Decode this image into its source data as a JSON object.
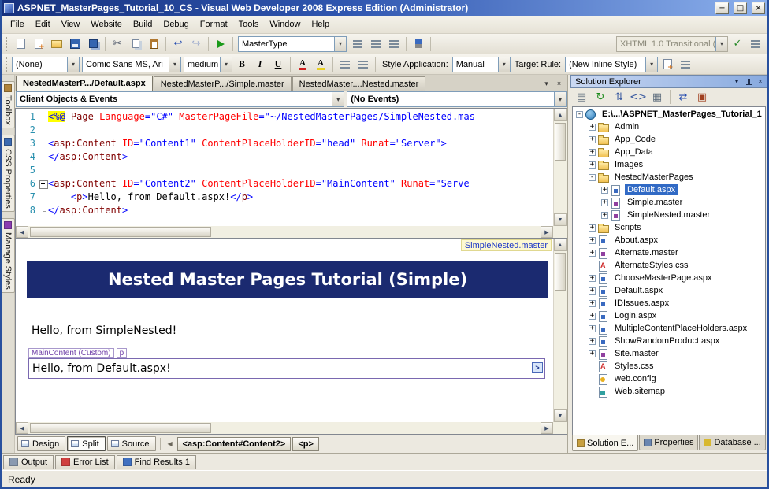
{
  "window": {
    "title": "ASPNET_MasterPages_Tutorial_10_CS - Visual Web Developer 2008 Express Edition (Administrator)"
  },
  "glyphs": {
    "up": "▲",
    "down": "▼",
    "left": "◀",
    "right": "▶",
    "dropdown": "▾",
    "close": "×",
    "minimize": "−",
    "maximize": "□"
  },
  "menu": {
    "items": [
      "File",
      "Edit",
      "View",
      "Website",
      "Build",
      "Debug",
      "Format",
      "Tools",
      "Window",
      "Help"
    ]
  },
  "toolbar_main": {
    "find_value": "MasterType",
    "doctype_value": "XHTML 1.0 Transitional (",
    "left_icons": [
      {
        "name": "new-web-site-icon",
        "type": "page"
      },
      {
        "name": "add-new-item-icon",
        "type": "page-plus"
      },
      {
        "name": "open-file-icon",
        "type": "folder"
      },
      {
        "name": "save-icon",
        "type": "floppy"
      },
      {
        "name": "save-all-icon",
        "type": "floppy-all"
      },
      {
        "type": "sep"
      },
      {
        "name": "cut-icon",
        "glyph": "✂",
        "color": "#555e6e"
      },
      {
        "name": "copy-icon",
        "type": "copy"
      },
      {
        "name": "paste-icon",
        "type": "paste"
      },
      {
        "type": "sep"
      },
      {
        "name": "undo-icon",
        "glyph": "↩",
        "color": "#2a50b0"
      },
      {
        "name": "redo-icon",
        "glyph": "↪",
        "color": "#2a50b0",
        "disabled": true
      },
      {
        "type": "sep"
      },
      {
        "name": "start-debugging-icon",
        "type": "play"
      },
      {
        "type": "sep"
      }
    ],
    "mid_icons": [
      {
        "name": "find-in-files-icon",
        "type": "lines"
      },
      {
        "name": "comment-selection-icon",
        "type": "lines"
      },
      {
        "name": "uncomment-selection-icon",
        "type": "lines"
      },
      {
        "type": "sep"
      },
      {
        "name": "bookmark-icon",
        "type": "flag"
      },
      {
        "type": "sep"
      }
    ],
    "right_icons": [
      {
        "name": "check-page-validation-icon",
        "glyph": "✓",
        "color": "#2a8a2a"
      },
      {
        "name": "validation-options-icon",
        "type": "lines"
      }
    ]
  },
  "toolbar_format": {
    "style_value": "(None)",
    "font_value": "Comic Sans MS, Ari",
    "size_value": "medium",
    "style_application_label": "Style Application:",
    "style_application_value": "Manual",
    "target_rule_label": "Target Rule:",
    "target_rule_value": "(New Inline Style)",
    "format_icons": [
      {
        "name": "bold-icon",
        "text": "B",
        "cls": "fmt-b"
      },
      {
        "name": "italic-icon",
        "text": "I",
        "cls": "fmt-i"
      },
      {
        "name": "underline-icon",
        "text": "U",
        "cls": "fmt-u"
      },
      {
        "type": "sep"
      },
      {
        "name": "font-color-icon",
        "text": "A",
        "cls": "tbi-fontcolor"
      },
      {
        "name": "highlight-color-icon",
        "text": "A",
        "cls": "tbi-highlight"
      },
      {
        "type": "sep"
      },
      {
        "name": "bullet-list-icon",
        "type": "lines"
      },
      {
        "name": "numbered-list-icon",
        "type": "lines"
      },
      {
        "type": "sep"
      }
    ],
    "right_icons": [
      {
        "name": "new-style-icon",
        "type": "page-plus"
      },
      {
        "name": "manage-styles-icon",
        "type": "lines"
      }
    ]
  },
  "left_tabs": [
    {
      "label": "Toolbox",
      "icon": "toolbox-icon",
      "color": "#b0843c"
    },
    {
      "label": "CSS Properties",
      "icon": "css-properties-icon",
      "color": "#3c6ab0"
    },
    {
      "label": "Manage Styles",
      "icon": "manage-styles-icon",
      "color": "#8a3cb0"
    }
  ],
  "doc_tabs": [
    {
      "label": "NestedMasterP.../Default.aspx",
      "active": true
    },
    {
      "label": "NestedMasterP.../Simple.master",
      "active": false
    },
    {
      "label": "NestedMaster....Nested.master",
      "active": false
    }
  ],
  "editor": {
    "object_dropdown": "Client Objects & Events",
    "event_dropdown": "(No Events)",
    "lines": [
      {
        "n": 1,
        "fold": "",
        "tokens": [
          {
            "c": "dir",
            "t": "<%@"
          },
          {
            "c": "plain",
            "t": " "
          },
          {
            "c": "tag",
            "t": "Page"
          },
          {
            "c": "plain",
            "t": " "
          },
          {
            "c": "attr",
            "t": "Language"
          },
          {
            "c": "delim",
            "t": "=\""
          },
          {
            "c": "val",
            "t": "C#"
          },
          {
            "c": "delim",
            "t": "\""
          },
          {
            "c": "plain",
            "t": " "
          },
          {
            "c": "attr",
            "t": "MasterPageFile"
          },
          {
            "c": "delim",
            "t": "=\""
          },
          {
            "c": "val",
            "t": "~/NestedMasterPages/SimpleNested.mas"
          }
        ]
      },
      {
        "n": 2,
        "fold": "",
        "tokens": []
      },
      {
        "n": 3,
        "fold": "",
        "tokens": [
          {
            "c": "delim",
            "t": "<"
          },
          {
            "c": "tag",
            "t": "asp:Content"
          },
          {
            "c": "plain",
            "t": " "
          },
          {
            "c": "attr",
            "t": "ID"
          },
          {
            "c": "delim",
            "t": "=\""
          },
          {
            "c": "val",
            "t": "Content1"
          },
          {
            "c": "delim",
            "t": "\""
          },
          {
            "c": "plain",
            "t": " "
          },
          {
            "c": "attr",
            "t": "ContentPlaceHolderID"
          },
          {
            "c": "delim",
            "t": "=\""
          },
          {
            "c": "val",
            "t": "head"
          },
          {
            "c": "delim",
            "t": "\""
          },
          {
            "c": "plain",
            "t": " "
          },
          {
            "c": "attr",
            "t": "Runat"
          },
          {
            "c": "delim",
            "t": "=\""
          },
          {
            "c": "val",
            "t": "Server"
          },
          {
            "c": "delim",
            "t": "\">"
          }
        ]
      },
      {
        "n": 4,
        "fold": "",
        "tokens": [
          {
            "c": "delim",
            "t": "</"
          },
          {
            "c": "tag",
            "t": "asp:Content"
          },
          {
            "c": "delim",
            "t": ">"
          }
        ]
      },
      {
        "n": 5,
        "fold": "",
        "tokens": []
      },
      {
        "n": 6,
        "fold": "start",
        "tokens": [
          {
            "c": "delim",
            "t": "<"
          },
          {
            "c": "tag",
            "t": "asp:Content"
          },
          {
            "c": "plain",
            "t": " "
          },
          {
            "c": "attr",
            "t": "ID"
          },
          {
            "c": "delim",
            "t": "=\""
          },
          {
            "c": "val",
            "t": "Content2"
          },
          {
            "c": "delim",
            "t": "\""
          },
          {
            "c": "plain",
            "t": " "
          },
          {
            "c": "attr",
            "t": "ContentPlaceHolderID"
          },
          {
            "c": "delim",
            "t": "=\""
          },
          {
            "c": "val",
            "t": "MainContent"
          },
          {
            "c": "delim",
            "t": "\""
          },
          {
            "c": "plain",
            "t": " "
          },
          {
            "c": "attr",
            "t": "Runat"
          },
          {
            "c": "delim",
            "t": "=\""
          },
          {
            "c": "val",
            "t": "Serve"
          }
        ]
      },
      {
        "n": 7,
        "fold": "mid",
        "tokens": [
          {
            "c": "plain",
            "t": "    "
          },
          {
            "c": "delim",
            "t": "<"
          },
          {
            "c": "tag",
            "t": "p"
          },
          {
            "c": "delim",
            "t": ">"
          },
          {
            "c": "plain",
            "t": "Hello, from Default.aspx!"
          },
          {
            "c": "delim",
            "t": "</"
          },
          {
            "c": "tag",
            "t": "p"
          },
          {
            "c": "delim",
            "t": ">"
          }
        ]
      },
      {
        "n": 8,
        "fold": "end",
        "tokens": [
          {
            "c": "delim",
            "t": "</"
          },
          {
            "c": "tag",
            "t": "asp:Content"
          },
          {
            "c": "delim",
            "t": ">"
          }
        ]
      }
    ]
  },
  "design": {
    "master_link": "SimpleNested.master",
    "banner_text": "Nested Master Pages Tutorial (Simple)",
    "master_text": "Hello, from SimpleNested!",
    "region_chip": "MainContent (Custom)",
    "tag_chip": "p",
    "content_text": "Hello, from Default.aspx!",
    "smart_tag_glyph": ">",
    "banner_color": "#1b2a70"
  },
  "view_bar": {
    "buttons": [
      {
        "label": "Design",
        "name": "design-view-button",
        "active": false
      },
      {
        "label": "Split",
        "name": "split-view-button",
        "active": true
      },
      {
        "label": "Source",
        "name": "source-view-button",
        "active": false
      }
    ],
    "tag_path": [
      {
        "label": "<asp:Content#Content2>",
        "name": "tag-nav-asp-content"
      },
      {
        "label": "<p>",
        "name": "tag-nav-p"
      }
    ]
  },
  "bottom_tabs": [
    {
      "label": "Output",
      "name": "output-tab",
      "icon_color": "#8a9ab0"
    },
    {
      "label": "Error List",
      "name": "error-list-tab",
      "icon_color": "#d04040"
    },
    {
      "label": "Find Results 1",
      "name": "find-results-tab",
      "icon_color": "#4070c0"
    }
  ],
  "status": {
    "text": "Ready"
  },
  "solution_explorer": {
    "title": "Solution Explorer",
    "toolbar_icons": [
      {
        "name": "properties-icon",
        "glyph": "▤",
        "color": "#5a6a7a"
      },
      {
        "name": "refresh-icon",
        "glyph": "↻",
        "color": "#1a8a1a"
      },
      {
        "name": "nest-related-files-icon",
        "glyph": "⇅",
        "color": "#3a5aa0"
      },
      {
        "name": "view-code-icon",
        "glyph": "<>",
        "color": "#3a5aa0"
      },
      {
        "name": "view-designer-icon",
        "glyph": "▦",
        "color": "#5a6a7a"
      },
      {
        "type": "sep"
      },
      {
        "name": "copy-web-site-icon",
        "glyph": "⇄",
        "color": "#2a50b0"
      },
      {
        "name": "aspnet-configuration-icon",
        "glyph": "▣",
        "color": "#a04020"
      }
    ],
    "tree": [
      {
        "label": "E:\\...\\ASPNET_MasterPages_Tutorial_1",
        "depth": 0,
        "icon": "website",
        "expander": "minus",
        "selected": false
      },
      {
        "label": "Admin",
        "depth": 1,
        "icon": "folder",
        "expander": "plus"
      },
      {
        "label": "App_Code",
        "depth": 1,
        "icon": "folder",
        "expander": "plus"
      },
      {
        "label": "App_Data",
        "depth": 1,
        "icon": "folder",
        "expander": "plus"
      },
      {
        "label": "Images",
        "depth": 1,
        "icon": "folder",
        "expander": "plus"
      },
      {
        "label": "NestedMasterPages",
        "depth": 1,
        "icon": "folder",
        "expander": "minus"
      },
      {
        "label": "Default.aspx",
        "depth": 2,
        "icon": "aspx",
        "expander": "plus",
        "selected": true
      },
      {
        "label": "Simple.master",
        "depth": 2,
        "icon": "master",
        "expander": "plus"
      },
      {
        "label": "SimpleNested.master",
        "depth": 2,
        "icon": "master",
        "expander": "plus"
      },
      {
        "label": "Scripts",
        "depth": 1,
        "icon": "folder",
        "expander": "plus"
      },
      {
        "label": "About.aspx",
        "depth": 1,
        "icon": "aspx",
        "expander": "plus"
      },
      {
        "label": "Alternate.master",
        "depth": 1,
        "icon": "master",
        "expander": "plus"
      },
      {
        "label": "AlternateStyles.css",
        "depth": 1,
        "icon": "css",
        "expander": "none"
      },
      {
        "label": "ChooseMasterPage.aspx",
        "depth": 1,
        "icon": "aspx",
        "expander": "plus"
      },
      {
        "label": "Default.aspx",
        "depth": 1,
        "icon": "aspx",
        "expander": "plus"
      },
      {
        "label": "IDIssues.aspx",
        "depth": 1,
        "icon": "aspx",
        "expander": "plus"
      },
      {
        "label": "Login.aspx",
        "depth": 1,
        "icon": "aspx",
        "expander": "plus"
      },
      {
        "label": "MultipleContentPlaceHolders.aspx",
        "depth": 1,
        "icon": "aspx",
        "expander": "plus"
      },
      {
        "label": "ShowRandomProduct.aspx",
        "depth": 1,
        "icon": "aspx",
        "expander": "plus"
      },
      {
        "label": "Site.master",
        "depth": 1,
        "icon": "master",
        "expander": "plus"
      },
      {
        "label": "Styles.css",
        "depth": 1,
        "icon": "css",
        "expander": "none"
      },
      {
        "label": "web.config",
        "depth": 1,
        "icon": "config",
        "expander": "none"
      },
      {
        "label": "Web.sitemap",
        "depth": 1,
        "icon": "sitemap",
        "expander": "none"
      }
    ],
    "panel_tabs": [
      {
        "label": "Solution E...",
        "name": "solution-explorer-tab",
        "active": true,
        "icon_color": "#c8a040"
      },
      {
        "label": "Properties",
        "name": "properties-tab",
        "active": false,
        "icon_color": "#6a86b0"
      },
      {
        "label": "Database ...",
        "name": "database-explorer-tab",
        "active": false,
        "icon_color": "#d8b830"
      }
    ]
  }
}
